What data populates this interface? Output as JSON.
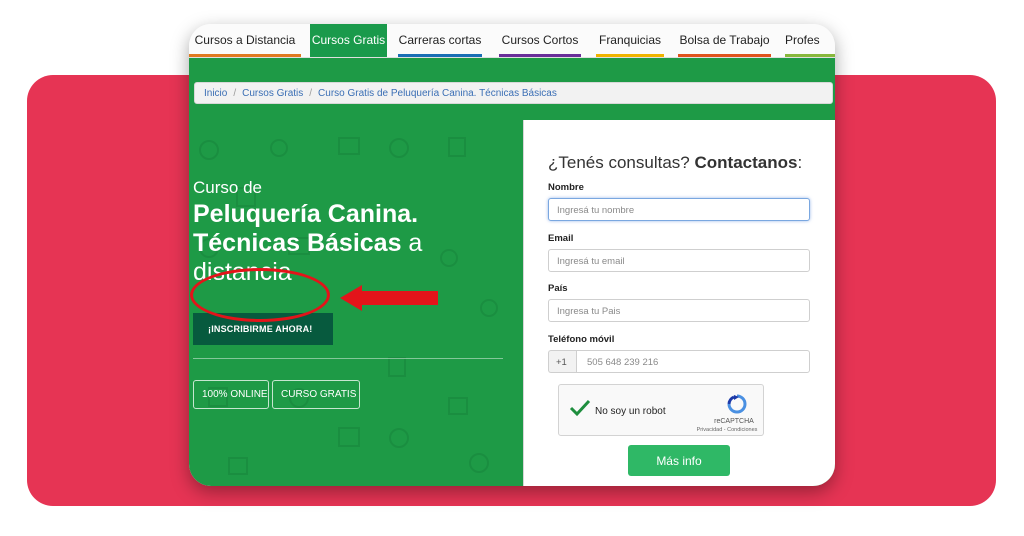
{
  "nav": {
    "items": [
      {
        "label": "Cursos a Distancia",
        "bar_color": "#e07a21"
      },
      {
        "label": "Cursos Gratis",
        "bar_color": "#1a9a4b",
        "active": true
      },
      {
        "label": "Carreras cortas",
        "bar_color": "#1a6fb5"
      },
      {
        "label": "Cursos Cortos",
        "bar_color": "#6a2f9a"
      },
      {
        "label": "Franquicias",
        "bar_color": "#f0b400"
      },
      {
        "label": "Bolsa de Trabajo",
        "bar_color": "#e0531d"
      },
      {
        "label": "Profes",
        "bar_color": "#88b83c"
      }
    ]
  },
  "breadcrumb": {
    "items": [
      "Inicio",
      "Cursos Gratis",
      "Curso Gratis de Peluquería Canina. Técnicas Básicas"
    ],
    "separator": "/"
  },
  "hero": {
    "prefix": "Curso de",
    "title_bold": "Peluquería Canina. Técnicas Básicas",
    "title_rest": " a distancia",
    "cta_label": "¡INSCRIBIRME AHORA!",
    "tags": [
      "100% ONLINE",
      "CURSO GRATIS"
    ]
  },
  "form": {
    "title_light": "¿Tenés consultas?",
    "title_bold": "Contactanos",
    "title_colon": ":",
    "fields": [
      {
        "label": "Nombre",
        "placeholder": "Ingresá tu nombre"
      },
      {
        "label": "Email",
        "placeholder": "Ingresá tu email"
      },
      {
        "label": "País",
        "placeholder": "Ingresa tu Pais"
      }
    ],
    "phone": {
      "label": "Teléfono móvil",
      "prefix": "+1",
      "placeholder": "505 648 239 216"
    },
    "captcha": {
      "text": "No soy un robot",
      "brand": "reCAPTCHA",
      "links": "Privacidad - Condiciones"
    },
    "submit_label": "Más info"
  },
  "colors": {
    "background_band": "#e63454",
    "hero_green": "#1e9a46",
    "cta_dark_green": "#075a3e",
    "submit_green": "#2fb866",
    "annotation_red": "#e3141a"
  }
}
